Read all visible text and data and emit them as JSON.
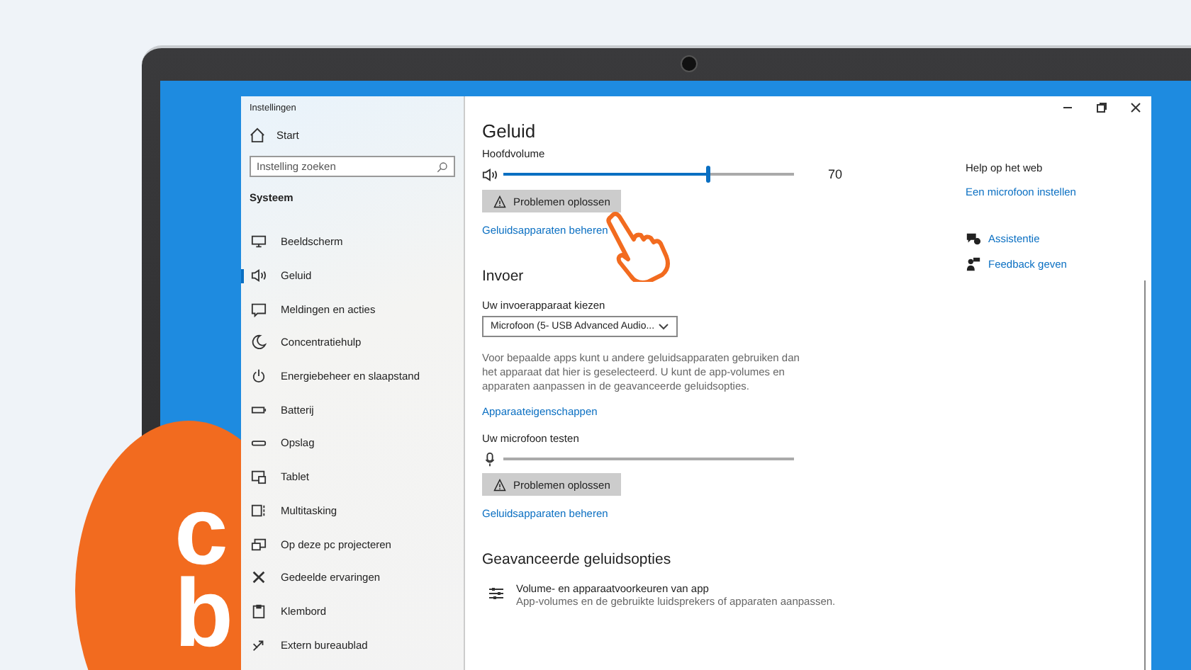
{
  "window": {
    "title": "Instellingen"
  },
  "wallpaper": {
    "letters": [
      "c",
      "b"
    ]
  },
  "sidebar": {
    "home": "Start",
    "search": {
      "placeholder": "Instelling zoeken"
    },
    "section": "Systeem",
    "items": [
      {
        "label": "Beeldscherm",
        "selected": false
      },
      {
        "label": "Geluid",
        "selected": true
      },
      {
        "label": "Meldingen en acties",
        "selected": false
      },
      {
        "label": "Concentratiehulp",
        "selected": false
      },
      {
        "label": "Energiebeheer en slaapstand",
        "selected": false
      },
      {
        "label": "Batterij",
        "selected": false
      },
      {
        "label": "Opslag",
        "selected": false
      },
      {
        "label": "Tablet",
        "selected": false
      },
      {
        "label": "Multitasking",
        "selected": false
      },
      {
        "label": "Op deze pc projecteren",
        "selected": false
      },
      {
        "label": "Gedeelde ervaringen",
        "selected": false
      },
      {
        "label": "Klembord",
        "selected": false
      },
      {
        "label": "Extern bureaublad",
        "selected": false
      }
    ]
  },
  "main": {
    "title": "Geluid",
    "output": {
      "label": "Hoofdvolume",
      "level": 0.7,
      "reading": "70",
      "button": "Problemen oplossen",
      "link": "Geluidsapparaten beheren"
    },
    "input": {
      "heading": "Invoer",
      "device_label": "Uw invoerapparaat kiezen",
      "device": "Microfoon (5- USB Advanced Audio...",
      "description": "Voor bepaalde apps kunt u andere geluidsapparaten gebruiken dan het apparaat dat hier is geselecteerd. U kunt de app-volumes en apparaten aanpassen in de geavanceerde geluidsopties.",
      "properties_link": "Apparaateigenschappen",
      "test_label": "Uw microfoon testen",
      "level": 0,
      "button": "Problemen oplossen",
      "link": "Geluidsapparaten beheren"
    },
    "advanced": {
      "heading": "Geavanceerde geluidsopties",
      "option_title": "Volume- en apparaatvoorkeuren van app",
      "option_desc": "App-volumes en de gebruikte luidsprekers of apparaten aanpassen."
    }
  },
  "help": {
    "heading": "Help op het web",
    "link": "Een microfoon instellen",
    "links": [
      "Assistentie",
      "Feedback geven"
    ]
  }
}
